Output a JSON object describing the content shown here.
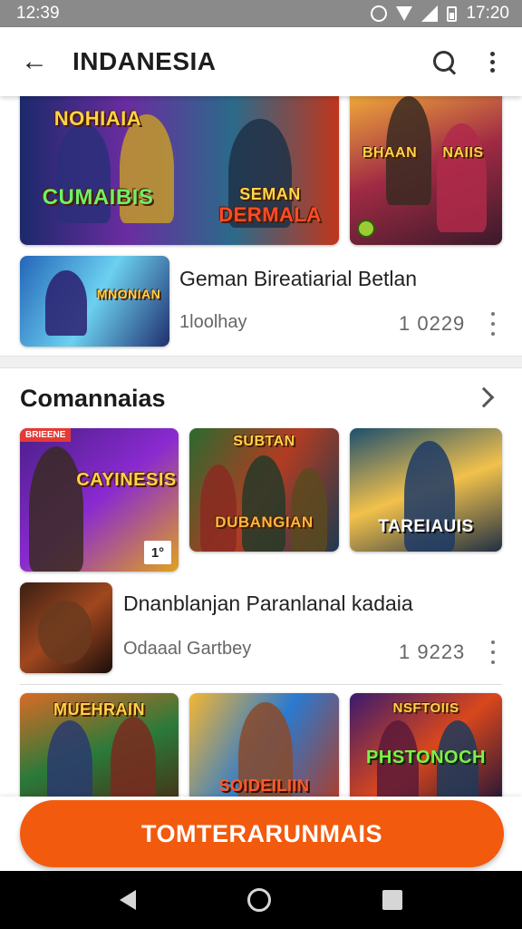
{
  "status_bar": {
    "time_left": "12:39",
    "time_right": "17:20"
  },
  "app_bar": {
    "title": "INDANESIA"
  },
  "section1": {
    "cards": [
      {
        "label_top": "NOHIAIA",
        "label_bottom": "CUMAIBIS",
        "colors": [
          "#1b2a6b",
          "#6a2ca0",
          "#d94b1f"
        ]
      },
      {
        "label_top": "SEMAN",
        "label_bottom": "DERMALA",
        "colors": [
          "#0e3550",
          "#2b6a8a",
          "#c0361c"
        ]
      },
      {
        "label_top": "BHAAN",
        "label_bottom": "NAIIS",
        "colors": [
          "#f6b23a",
          "#a02a44",
          "#3a1a2a"
        ]
      }
    ],
    "list_item": {
      "thumb_label": "MNONIAN",
      "thumb_colors": [
        "#2465b8",
        "#6cd0f0",
        "#1f2f6e"
      ],
      "title": "Geman Bireatiarial Betlan",
      "meta": "1loolhay",
      "count": "1 0229"
    }
  },
  "section2": {
    "title": "Comannaias",
    "cards": [
      {
        "label": "CAYINESIS",
        "badge_new": "BRIEENE",
        "rank": "1°",
        "colors": [
          "#4a1f88",
          "#8a2ad0",
          "#e0a21e"
        ]
      },
      {
        "label": "DUBANGIAN",
        "label_top": "SUBTAN",
        "colors": [
          "#2a6a2e",
          "#b23c22",
          "#1d3a50"
        ]
      },
      {
        "label": "TAREIAUIS",
        "colors": [
          "#1d4f6e",
          "#f2c14b",
          "#203044"
        ]
      }
    ],
    "list_item": {
      "thumb_colors": [
        "#3a1f14",
        "#a0471e",
        "#1a0e0b"
      ],
      "title": "Dnanblanjan Paranlanal kadaia",
      "meta": "Odaaal Gartbey",
      "count": "1 9223"
    },
    "cards_row2": [
      {
        "label": "MUEHRAIN",
        "colors": [
          "#d96b25",
          "#2a7a3a",
          "#4a2a12"
        ]
      },
      {
        "label": "SOIDEILIIN",
        "colors": [
          "#f4b633",
          "#2a7ad0",
          "#b23b22"
        ]
      },
      {
        "label": "PHSTONOCH",
        "label_top": "NSFTOIIS",
        "colors": [
          "#3a1a6e",
          "#d9471c",
          "#17123a"
        ]
      }
    ]
  },
  "cta": {
    "label": "TOMTERARUNMAIS"
  }
}
